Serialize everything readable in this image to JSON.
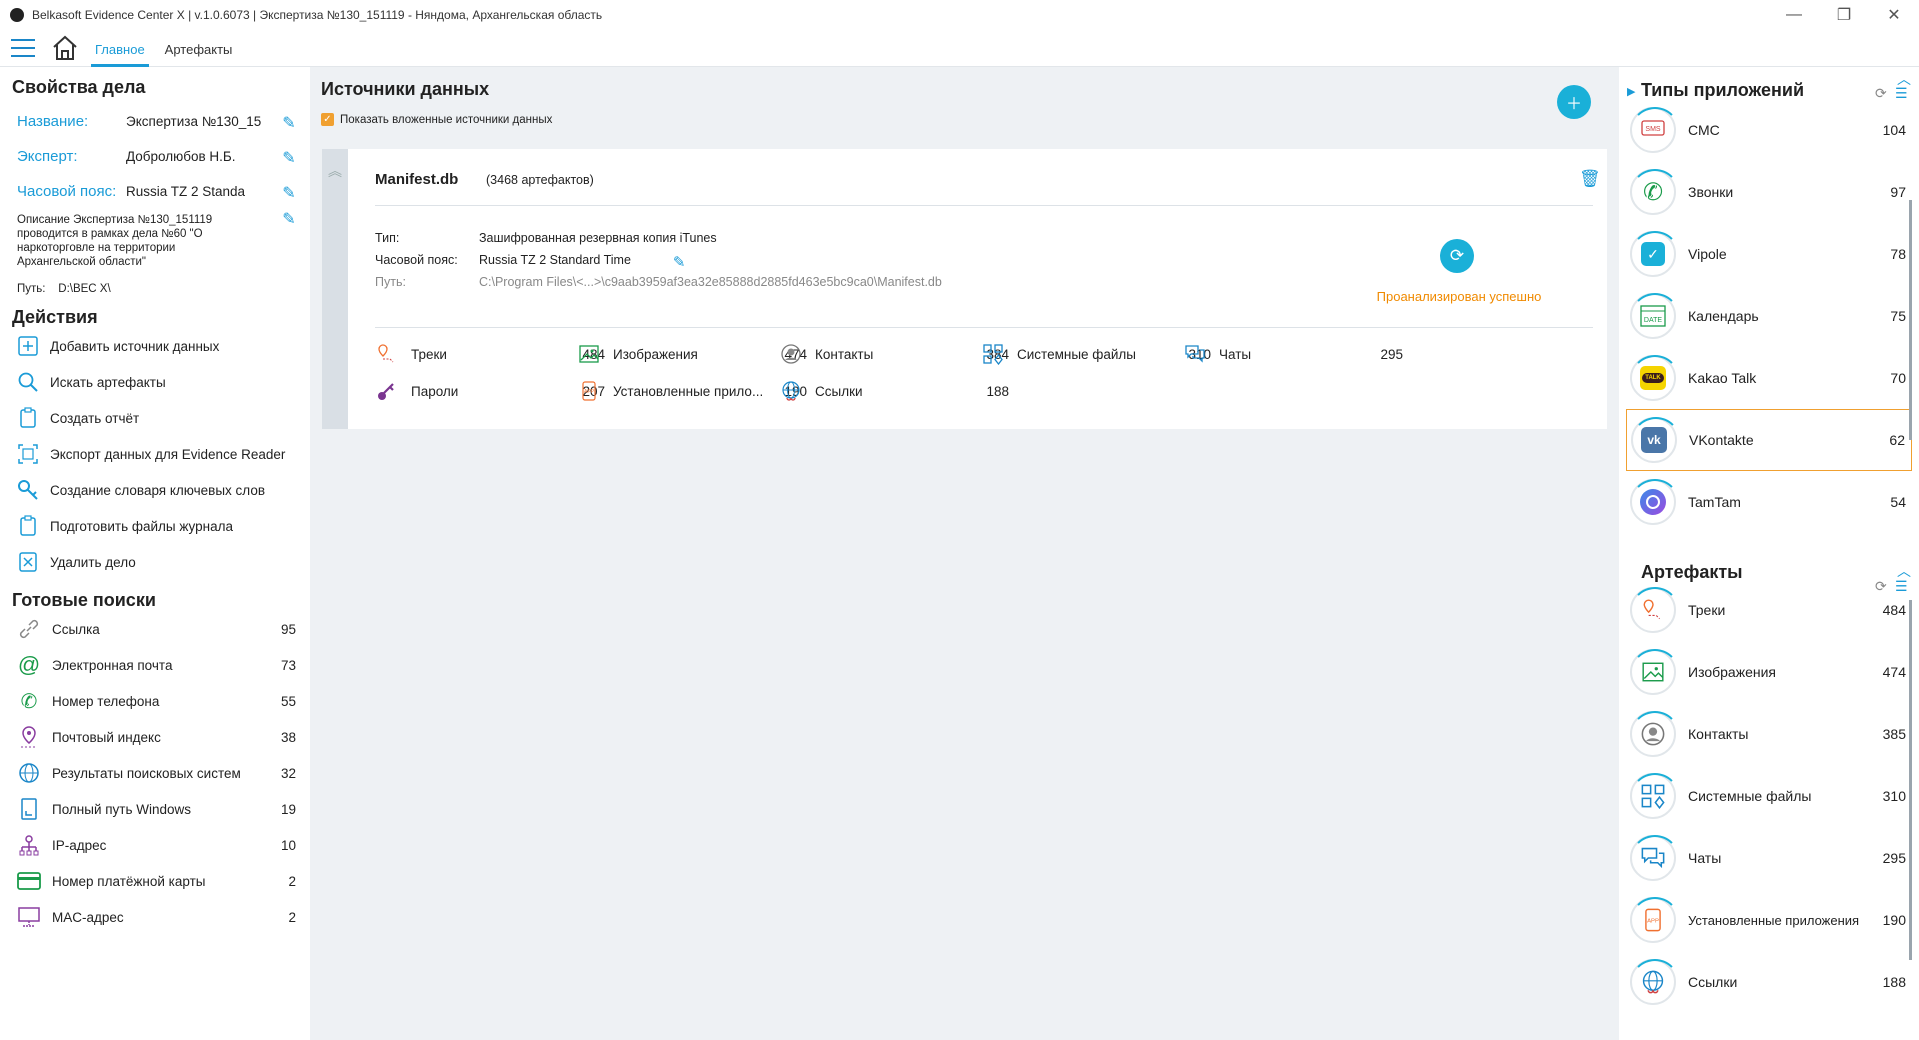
{
  "window": {
    "title": "Belkasoft Evidence Center X | v.1.0.6073 | Экспертиза №130_151119 - Няндома, Архангельская область"
  },
  "tabs": [
    {
      "label": "Главное"
    },
    {
      "label": "Артефакты"
    }
  ],
  "case": {
    "heading": "Свойства дела",
    "name_label": "Название:",
    "name_value": "Экспертиза №130_15",
    "expert_label": "Эксперт:",
    "expert_value": "Добролюбов Н.Б.",
    "tz_label": "Часовой пояс:",
    "tz_value": "Russia TZ 2 Standa",
    "description": "Описание Экспертиза №130_151119 проводится в рамках дела №60 \"О наркоторговле на территории Архангельской области\"",
    "path_label": "Путь:",
    "path_value": "D:\\BEC X\\"
  },
  "actions": {
    "heading": "Действия",
    "items": [
      {
        "label": "Добавить источник данных",
        "icon": "add-source-icon"
      },
      {
        "label": "Искать артефакты",
        "icon": "search-icon"
      },
      {
        "label": "Создать отчёт",
        "icon": "report-icon"
      },
      {
        "label": "Экспорт данных для Evidence Reader",
        "icon": "export-icon"
      },
      {
        "label": "Создание словаря ключевых слов",
        "icon": "key-icon"
      },
      {
        "label": "Подготовить файлы журнала",
        "icon": "log-icon"
      },
      {
        "label": "Удалить дело",
        "icon": "delete-icon"
      }
    ]
  },
  "searches": {
    "heading": "Готовые поиски",
    "items": [
      {
        "label": "Ссылка",
        "count": "95"
      },
      {
        "label": "Электронная почта",
        "count": "73"
      },
      {
        "label": "Номер телефона",
        "count": "55"
      },
      {
        "label": "Почтовый индекс",
        "count": "38"
      },
      {
        "label": "Результаты поисковых систем",
        "count": "32"
      },
      {
        "label": "Полный путь Windows",
        "count": "19"
      },
      {
        "label": "IP-адрес",
        "count": "10"
      },
      {
        "label": "Номер платёжной карты",
        "count": "2"
      },
      {
        "label": "MAC-адрес",
        "count": "2"
      }
    ]
  },
  "sources": {
    "heading": "Источники данных",
    "show_nested": "Показать вложенные источники данных",
    "card": {
      "name": "Manifest.db",
      "count": "(3468 артефактов)",
      "type_label": "Тип:",
      "type_value": "Зашифрованная резервная копия iTunes",
      "tz_label": "Часовой пояс:",
      "tz_value": "Russia TZ 2 Standard Time",
      "path_label": "Путь:",
      "path_value": "C:\\Program Files\\<...>\\c9aab3959af3ea32e85888d2885fd463e5bc9ca0\\Manifest.db",
      "status": "Проанализирован успешно",
      "artifacts": [
        {
          "label": "Треки",
          "count": "484"
        },
        {
          "label": "Изображения",
          "count": "474"
        },
        {
          "label": "Контакты",
          "count": "384"
        },
        {
          "label": "Системные файлы",
          "count": "310"
        },
        {
          "label": "Чаты",
          "count": "295"
        },
        {
          "label": "Пароли",
          "count": "207"
        },
        {
          "label": "Установленные прило...",
          "count": "190"
        },
        {
          "label": "Ссылки",
          "count": "188"
        }
      ]
    }
  },
  "app_types": {
    "heading": "Типы приложений",
    "items": [
      {
        "label": "СМС",
        "count": "104"
      },
      {
        "label": "Звонки",
        "count": "97"
      },
      {
        "label": "Vipole",
        "count": "78"
      },
      {
        "label": "Календарь",
        "count": "75"
      },
      {
        "label": "Kakao Talk",
        "count": "70"
      },
      {
        "label": "VKontakte",
        "count": "62"
      },
      {
        "label": "TamTam",
        "count": "54"
      }
    ]
  },
  "artifacts_panel": {
    "heading": "Артефакты",
    "items": [
      {
        "label": "Треки",
        "count": "484"
      },
      {
        "label": "Изображения",
        "count": "474"
      },
      {
        "label": "Контакты",
        "count": "385"
      },
      {
        "label": "Системные файлы",
        "count": "310"
      },
      {
        "label": "Чаты",
        "count": "295"
      },
      {
        "label": "Установленные приложения",
        "count": "190"
      },
      {
        "label": "Ссылки",
        "count": "188"
      }
    ]
  },
  "icon_texts": {
    "sms": "SMS",
    "date": "DATE",
    "talk": "TALK",
    "app": "APP"
  },
  "colors": {
    "accent": "#1a9bd7",
    "status": "#f08a00",
    "selection": "#f0a030"
  }
}
